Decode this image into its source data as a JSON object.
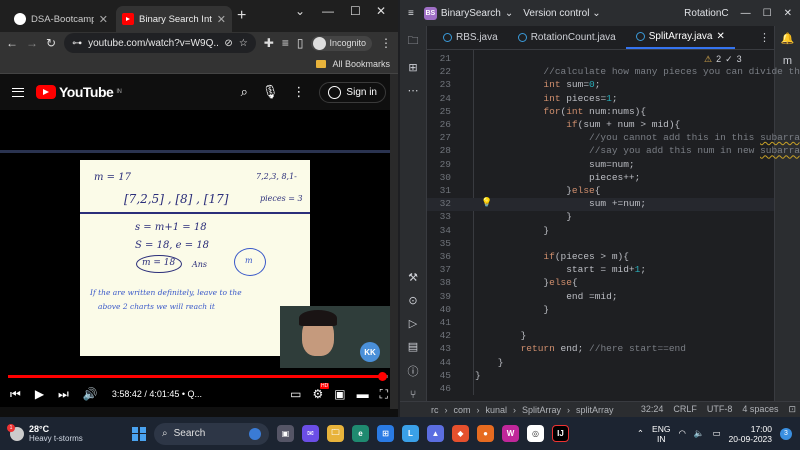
{
  "chrome": {
    "tabs": [
      {
        "label": "DSA-Bootcamp-Java/",
        "active": false
      },
      {
        "label": "Binary Search Intervie",
        "active": true
      }
    ],
    "url": "youtube.com/watch?v=W9Q...",
    "incognito_label": "Incognito",
    "bookmarks_label": "All Bookmarks"
  },
  "youtube": {
    "logo_text": "YouTube",
    "region": "IN",
    "signin_label": "Sign in",
    "time_display": "3:58:42 / 4:01:45 • Q...",
    "progress_fraction": 0.988
  },
  "board": {
    "top_left": "m = 17",
    "top_right": "7,2,3, 8,1-",
    "groups": "[7,2,5] , [8] , [17]",
    "pieces": "pieces = 3",
    "eq1": "s = m+1 = 18",
    "eq2": "S = 18, e = 18",
    "ans_circle": "m = 18",
    "ans": "Ans",
    "circle_small": "m",
    "note1": "If the are written definitely, leave to the",
    "note2": "above 2 charts we will reach it"
  },
  "ide": {
    "project": "BinarySearch",
    "project_badge": "BS",
    "vcs": "Version control",
    "run_config": "RotationC",
    "tabs": [
      "RBS.java",
      "RotationCount.java",
      "SplitArray.java"
    ],
    "active_tab": "SplitArray.java",
    "inspections": {
      "warnings": "2",
      "weak": "3"
    },
    "breadcrumbs": [
      "rc",
      "com",
      "kunal",
      "SplitArray",
      "splitArray"
    ],
    "status": {
      "position": "32:24",
      "line_sep": "CRLF",
      "encoding": "UTF-8",
      "indent": "4 spaces"
    },
    "current_line": 32,
    "code_lines": [
      {
        "n": "21",
        "t": ""
      },
      {
        "n": "22",
        "t": "            //calculate how many pieces you can divide this"
      },
      {
        "n": "23",
        "t": "            int sum=0;"
      },
      {
        "n": "24",
        "t": "            int pieces=1;"
      },
      {
        "n": "25",
        "t": "            for(int num:nums){"
      },
      {
        "n": "26",
        "t": "                if(sum + num > mid){"
      },
      {
        "n": "27",
        "t": "                    //you cannot add this in this subarray,"
      },
      {
        "n": "28",
        "t": "                    //say you add this num in new subarray,"
      },
      {
        "n": "29",
        "t": "                    sum=num;"
      },
      {
        "n": "30",
        "t": "                    pieces++;"
      },
      {
        "n": "31",
        "t": "                }else{"
      },
      {
        "n": "32",
        "t": "                    sum +=num;"
      },
      {
        "n": "33",
        "t": "                }"
      },
      {
        "n": "34",
        "t": "            }"
      },
      {
        "n": "35",
        "t": ""
      },
      {
        "n": "36",
        "t": "            if(pieces > m){"
      },
      {
        "n": "37",
        "t": "                start = mid+1;"
      },
      {
        "n": "38",
        "t": "            }else{"
      },
      {
        "n": "39",
        "t": "                end =mid;"
      },
      {
        "n": "40",
        "t": "            }"
      },
      {
        "n": "41",
        "t": ""
      },
      {
        "n": "42",
        "t": "        }"
      },
      {
        "n": "43",
        "t": "        return end; //here start==end"
      },
      {
        "n": "44",
        "t": "    }"
      },
      {
        "n": "45",
        "t": "}"
      },
      {
        "n": "46",
        "t": ""
      }
    ]
  },
  "taskbar": {
    "weather_temp": "28°C",
    "weather_desc": "Heavy t-storms",
    "weather_alert": "1",
    "search_label": "Search",
    "lang_line1": "ENG",
    "lang_line2": "IN",
    "time": "17:00",
    "date": "20-09-2023",
    "notif_count": "3"
  }
}
